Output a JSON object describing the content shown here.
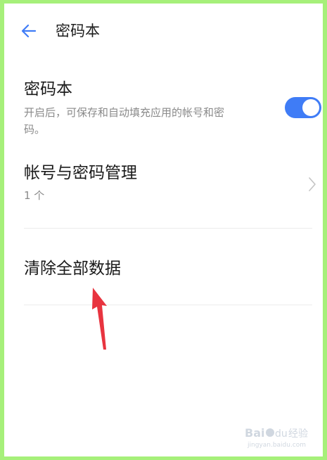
{
  "header": {
    "back_icon": "arrow-left-icon",
    "title": "密码本"
  },
  "password_book": {
    "title": "密码本",
    "description_line1": "开启后，可保存和自动填充应用的帐号和密",
    "description_line2": "码。",
    "toggle_state": "on"
  },
  "account_management": {
    "title": "帐号与密码管理",
    "count": "1 个",
    "chevron_icon": "chevron-right-icon"
  },
  "clear_data": {
    "title": "清除全部数据"
  },
  "overlay": {
    "arrow_icon": "red-arrow-up-icon"
  },
  "watermark": {
    "text_main": "Bai",
    "text_paw": "du",
    "text_cn": "经验",
    "url": "jingyan.baidu.com"
  },
  "colors": {
    "accent": "#3f7cf6",
    "border": "#a6f07a",
    "arrow": "#e8343f"
  }
}
